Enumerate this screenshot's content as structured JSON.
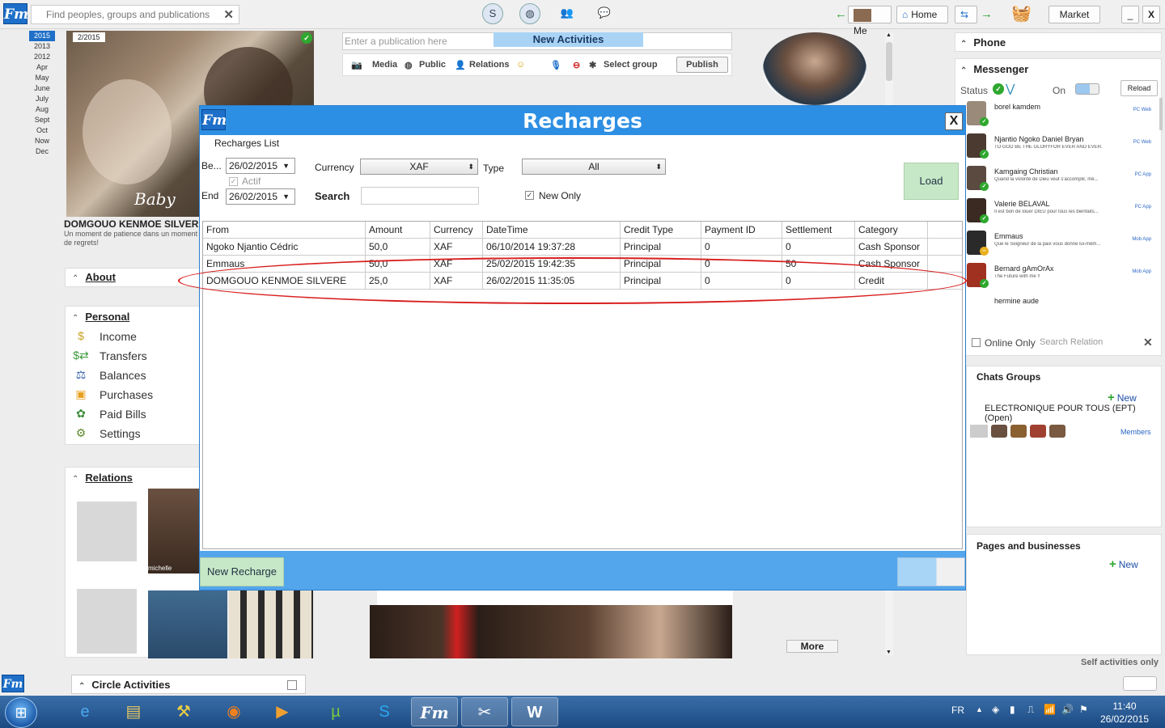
{
  "topbar": {
    "search_placeholder": "Find peoples, groups and publications",
    "me_label": "Me",
    "home_label": "Home",
    "market_label": "Market",
    "minimize_label": "_",
    "close_label": "X"
  },
  "timeline": {
    "years": [
      "2015",
      "2013",
      "2012"
    ],
    "months": [
      "Apr",
      "May",
      "June",
      "July",
      "Aug",
      "Sept",
      "Oct",
      "Now",
      "Dec"
    ]
  },
  "profile": {
    "photo_date": "2/2015",
    "name": "DOMGOUO KENMOE SILVERE",
    "quote": "Un moment de patience dans un moment de regrets!"
  },
  "about": {
    "label": "About"
  },
  "personal": {
    "label": "Personal",
    "items": [
      {
        "label": "Income",
        "icon": "dollar-icon"
      },
      {
        "label": "Transfers",
        "icon": "transfer-icon"
      },
      {
        "label": "Balances",
        "icon": "scale-icon"
      },
      {
        "label": "Purchases",
        "icon": "cart-icon"
      },
      {
        "label": "Paid Bills",
        "icon": "bill-icon"
      },
      {
        "label": "Settings",
        "icon": "gear-icon"
      }
    ]
  },
  "relations": {
    "label": "Relations",
    "people": [
      "michelle"
    ]
  },
  "circle_activities": {
    "label": "Circle Activities"
  },
  "feed": {
    "publication_placeholder": "Enter a publication here",
    "new_activities": "New Activities",
    "toolbar": {
      "media": "Media",
      "public": "Public",
      "relations": "Relations",
      "select_group": "Select group",
      "publish": "Publish"
    },
    "more_label": "More"
  },
  "phone": {
    "label": "Phone"
  },
  "messenger": {
    "label": "Messenger",
    "status_label": "Status",
    "on_label": "On",
    "reload_label": "Reload",
    "contacts": [
      {
        "name": "borel kamdem",
        "status": "",
        "device": "PC Web"
      },
      {
        "name": "Njantio Ngoko Daniel Bryan",
        "status": "TO GOD BE THE GLORYFOR EVER AND EVER.",
        "device": "PC Web"
      },
      {
        "name": "Kamgaing Christian",
        "status": "Quand la volonté de Dieu veut s'accomplir, mê...",
        "device": "PC App"
      },
      {
        "name": "Valerie BELAVAL",
        "status": "Il est bon de louer DIEU pour tous les bienfaits...",
        "device": "PC App"
      },
      {
        "name": "Emmaus",
        "status": "Que le Seigneur de la paix vous donne lui-mêm...",
        "device": "Mob App"
      },
      {
        "name": "Bernard gAmOrAx",
        "status": "The Future with me !!",
        "device": "Mob App"
      },
      {
        "name": "hermine aude",
        "status": "",
        "device": ""
      }
    ],
    "online_only_label": "Online Only",
    "search_relation_placeholder": "Search Relation"
  },
  "chats_groups": {
    "label": "Chats Groups",
    "new_label": "New",
    "group_name": "ELECTRONIQUE POUR TOUS (EPT) (Open)",
    "members_label": "Members"
  },
  "pages_businesses": {
    "label": "Pages and businesses",
    "new_label": "New"
  },
  "self_activities_label": "Self activities only",
  "modal": {
    "title": "Recharges",
    "close_label": "X",
    "list_label": "Recharges List",
    "begin_label": "Be...",
    "begin_date": "26/02/2015",
    "actif_label": "Actif",
    "end_label": "End",
    "end_date": "26/02/2015",
    "currency_label": "Currency",
    "currency_value": "XAF",
    "type_label": "Type",
    "type_value": "All",
    "search_label": "Search",
    "search_value": "",
    "new_only_label": "New Only",
    "load_label": "Load",
    "columns": [
      "From",
      "Amount",
      "Currency",
      "DateTime",
      "Credit Type",
      "Payment ID",
      "Settlement",
      "Category"
    ],
    "rows": [
      [
        "Ngoko Njantio Cédric",
        "50,0",
        "XAF",
        "06/10/2014 19:37:28",
        "Principal",
        "0",
        "0",
        "Cash Sponsor"
      ],
      [
        "Emmaus",
        "50,0",
        "XAF",
        "25/02/2015 19:42:35",
        "Principal",
        "0",
        "50",
        "Cash Sponsor"
      ],
      [
        "DOMGOUO KENMOE SILVERE",
        "25,0",
        "XAF",
        "26/02/2015 11:35:05",
        "Principal",
        "0",
        "0",
        "Credit"
      ]
    ],
    "new_recharge_label": "New Recharge"
  },
  "taskbar": {
    "language": "FR",
    "time": "11:40",
    "date": "26/02/2015"
  }
}
